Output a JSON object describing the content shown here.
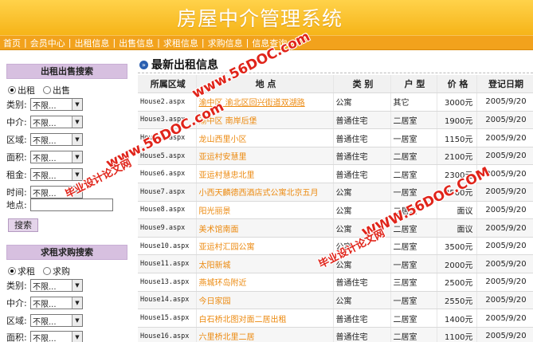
{
  "header": {
    "title": "房屋中介管理系统"
  },
  "nav": {
    "items": [
      "首页",
      "会员中心",
      "出租信息",
      "出售信息",
      "求租信息",
      "求购信息",
      "信息查询"
    ]
  },
  "sidebar": {
    "rent_sale": {
      "title": "出租出售搜索",
      "radio1": "出租",
      "radio2": "出售",
      "fields": [
        {
          "label": "类别:",
          "value": "不限..."
        },
        {
          "label": "中介:",
          "value": "不限..."
        },
        {
          "label": "区域:",
          "value": "不限..."
        },
        {
          "label": "面积:",
          "value": "不限..."
        },
        {
          "label": "租金:",
          "value": "不限..."
        },
        {
          "label": "时间:",
          "value": "不限..."
        }
      ],
      "address_label": "地点:",
      "search_button": "搜索"
    },
    "want": {
      "title": "求租求购搜索",
      "radio1": "求租",
      "radio2": "求购",
      "fields": [
        {
          "label": "类别:",
          "value": "不限..."
        },
        {
          "label": "中介:",
          "value": "不限..."
        },
        {
          "label": "区域:",
          "value": "不限..."
        },
        {
          "label": "面积:",
          "value": "不限..."
        }
      ]
    }
  },
  "main": {
    "title": "最新出租信息",
    "columns": [
      "所属区域",
      "地 点",
      "类 别",
      "户 型",
      "价 格",
      "登记日期"
    ],
    "rows": [
      [
        "House2.aspx",
        "渝中区 渝北区回兴街道双湖路",
        "公寓",
        "其它",
        "3000元",
        "2005/9/20"
      ],
      [
        "House3.aspx",
        "渝中区 南岸后堡",
        "普通住宅",
        "二居室",
        "1900元",
        "2005/9/20"
      ],
      [
        "House5.aspx",
        "龙山西里小区",
        "普通住宅",
        "一居室",
        "1150元",
        "2005/9/20"
      ],
      [
        "House5.aspx",
        "亚运村安慧里",
        "普通住宅",
        "二居室",
        "2100元",
        "2005/9/20"
      ],
      [
        "House6.aspx",
        "亚运村慧忠北里",
        "普通住宅",
        "二居室",
        "2300元",
        "2005/9/20"
      ],
      [
        "House7.aspx",
        "小西天麟德西酒店式公寓北京五月",
        "公寓",
        "一居室",
        "2500元",
        "2005/9/20"
      ],
      [
        "House8.aspx",
        "阳光丽景",
        "公寓",
        "二居室",
        "面议",
        "2005/9/20"
      ],
      [
        "House9.aspx",
        "美术馆南面",
        "公寓",
        "二居室",
        "面议",
        "2005/9/20"
      ],
      [
        "House10.aspx",
        "亚运村汇园公寓",
        "公寓",
        "二居室",
        "3500元",
        "2005/9/20"
      ],
      [
        "House11.aspx",
        "太阳新城",
        "公寓",
        "一居室",
        "2000元",
        "2005/9/20"
      ],
      [
        "House13.aspx",
        "燕城环岛附近",
        "普通住宅",
        "三居室",
        "2500元",
        "2005/9/20"
      ],
      [
        "House14.aspx",
        "今日家园",
        "公寓",
        "一居室",
        "2550元",
        "2005/9/20"
      ],
      [
        "House15.aspx",
        "白石桥北图对面二居出租",
        "普通住宅",
        "二居室",
        "1400元",
        "2005/9/20"
      ],
      [
        "House16.aspx",
        "六里桥北里二居",
        "普通住宅",
        "二居室",
        "1100元",
        "2005/9/20"
      ]
    ]
  },
  "watermarks": {
    "site": "www.56DOC.com",
    "label": "毕业设计论文网",
    "site_upper": "WWW.56DOC.COM"
  },
  "colors": {
    "banner": "#f6b418",
    "nav": "#f2a21c",
    "panel": "#d7c0e0",
    "link": "#ec8a10",
    "watermark": "#e0241a"
  }
}
